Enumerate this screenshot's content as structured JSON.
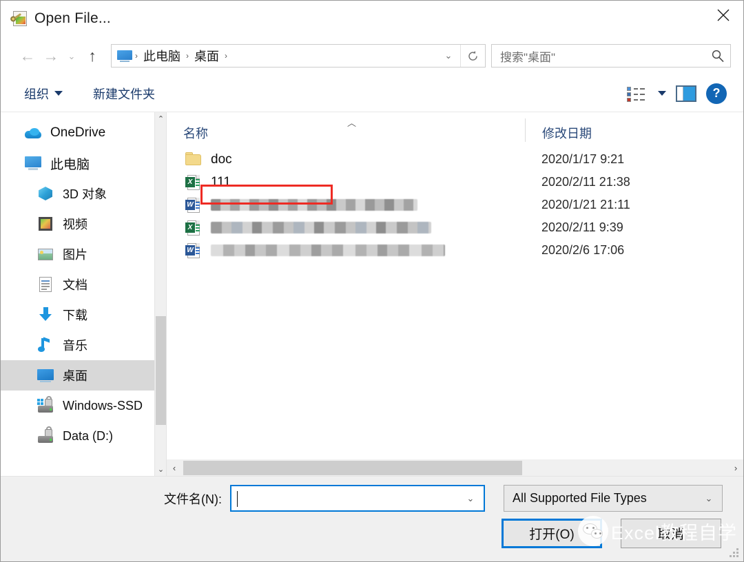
{
  "window": {
    "title": "Open File...",
    "title_icon": "open-file-icon",
    "close_label": "✕"
  },
  "navigation": {
    "back_icon": "arrow-left-icon",
    "forward_icon": "arrow-right-icon",
    "recent_icon": "chevron-down-icon",
    "up_icon": "arrow-up-icon",
    "address": {
      "root_icon": "this-pc-icon",
      "crumbs": [
        "此电脑",
        "桌面"
      ],
      "separator": "›",
      "dropdown_icon": "chevron-down-icon",
      "refresh_icon": "refresh-icon"
    },
    "search": {
      "placeholder": "搜索\"桌面\"",
      "value": "",
      "icon": "search-icon"
    }
  },
  "toolbar": {
    "organize_label": "组织",
    "organize_caret": "▼",
    "new_folder_label": "新建文件夹",
    "view_icon": "view-list-icon",
    "view_caret_icon": "chevron-down-icon",
    "preview_pane_icon": "preview-pane-icon",
    "help_icon": "help-icon",
    "help_label": "?"
  },
  "sidebar": {
    "items": [
      {
        "label": "OneDrive",
        "icon": "onedrive-icon",
        "level": 1,
        "selected": false
      },
      {
        "label": "此电脑",
        "icon": "this-pc-icon",
        "level": 1,
        "selected": false
      },
      {
        "label": "3D 对象",
        "icon": "3d-objects-icon",
        "level": 2,
        "selected": false
      },
      {
        "label": "视频",
        "icon": "videos-icon",
        "level": 2,
        "selected": false
      },
      {
        "label": "图片",
        "icon": "pictures-icon",
        "level": 2,
        "selected": false
      },
      {
        "label": "文档",
        "icon": "documents-icon",
        "level": 2,
        "selected": false
      },
      {
        "label": "下载",
        "icon": "downloads-icon",
        "level": 2,
        "selected": false
      },
      {
        "label": "音乐",
        "icon": "music-icon",
        "level": 2,
        "selected": false
      },
      {
        "label": "桌面",
        "icon": "desktop-icon",
        "level": 2,
        "selected": true
      },
      {
        "label": "Windows-SSD",
        "icon": "windows-drive-icon",
        "level": 2,
        "selected": false
      },
      {
        "label": "Data (D:)",
        "icon": "drive-icon",
        "level": 2,
        "selected": false
      }
    ],
    "scroll_up_icon": "chevron-up-icon",
    "scroll_down_icon": "chevron-down-icon"
  },
  "filelist": {
    "columns": {
      "name": "名称",
      "date_modified": "修改日期",
      "sort_caret": "︿"
    },
    "rows": [
      {
        "name": "doc",
        "icon": "folder-icon",
        "redacted": false,
        "date": "2020/1/17 9:21",
        "highlighted": false
      },
      {
        "name": "111",
        "icon": "excel-file-icon",
        "redacted": false,
        "date": "2020/2/11 21:38",
        "highlighted": true
      },
      {
        "name": "",
        "icon": "word-file-icon",
        "redacted": true,
        "date": "2020/1/21 21:11",
        "highlighted": false
      },
      {
        "name": "",
        "icon": "excel-file-icon",
        "redacted": true,
        "date": "2020/2/11 9:39",
        "highlighted": false
      },
      {
        "name": "",
        "icon": "word-file-icon",
        "redacted": true,
        "date": "2020/2/6 17:06",
        "highlighted": false
      }
    ],
    "hscroll_left_icon": "chevron-left-icon",
    "hscroll_right_icon": "chevron-right-icon"
  },
  "footer": {
    "filename_label": "文件名(N):",
    "filename_value": "",
    "filename_dropdown_icon": "chevron-down-icon",
    "filetype_value": "All Supported File Types",
    "filetype_dropdown_icon": "chevron-down-icon",
    "open_button": "打开(O)",
    "cancel_button": "取消",
    "resize_grip_icon": "resize-grip-icon"
  },
  "watermark": {
    "text": "Excel教程自学",
    "logo_icon": "wechat-logo-icon"
  },
  "colors": {
    "accent": "#0078d7",
    "highlight_box": "#ee2b24",
    "selection": "#d8d8d8",
    "link_text": "#1a3a6b"
  }
}
